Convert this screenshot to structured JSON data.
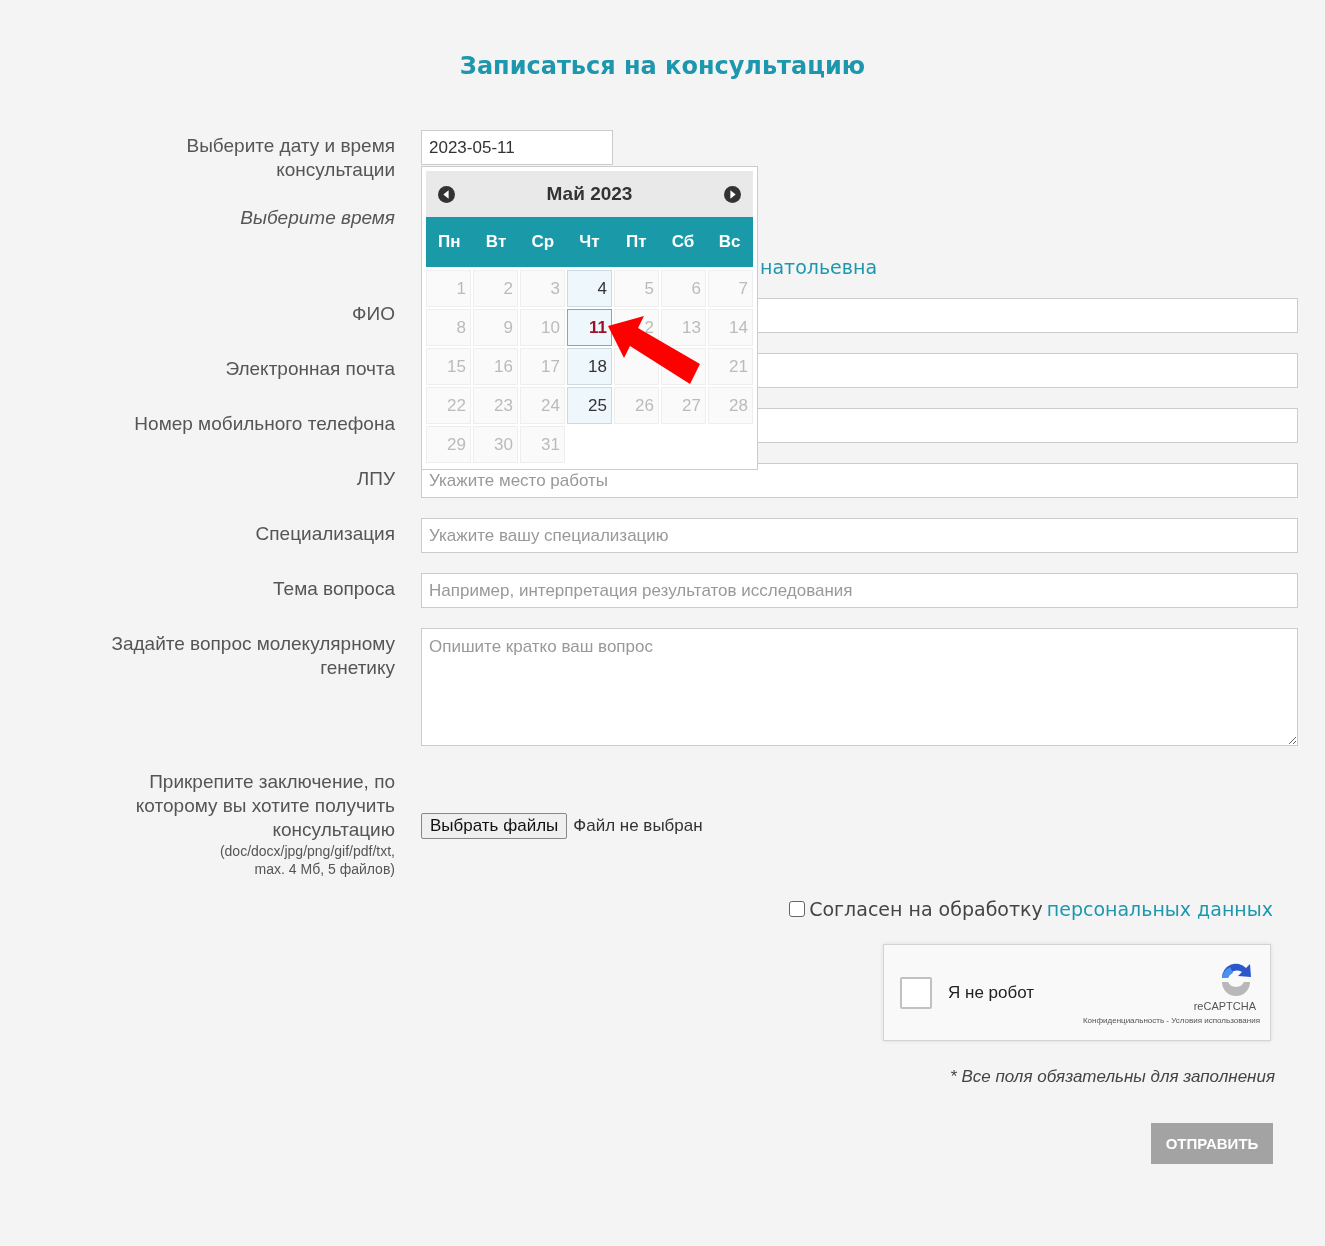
{
  "title": "Записаться на консультацию",
  "date_field": {
    "label": "Выберите дату и время консультации",
    "value": "2023-05-11"
  },
  "datepicker": {
    "month": "Май 2023",
    "weekdays": [
      "Пн",
      "Вт",
      "Ср",
      "Чт",
      "Пт",
      "Сб",
      "Вс"
    ],
    "weeks": [
      [
        {
          "text": "1",
          "kind": "disabled",
          "selected": false
        },
        {
          "text": "2",
          "kind": "disabled",
          "selected": false
        },
        {
          "text": "3",
          "kind": "disabled",
          "selected": false
        },
        {
          "text": "4",
          "kind": "available",
          "selected": false
        },
        {
          "text": "5",
          "kind": "disabled",
          "selected": false
        },
        {
          "text": "6",
          "kind": "disabled",
          "selected": false
        },
        {
          "text": "7",
          "kind": "disabled",
          "selected": false
        }
      ],
      [
        {
          "text": "8",
          "kind": "disabled",
          "selected": false
        },
        {
          "text": "9",
          "kind": "disabled",
          "selected": false
        },
        {
          "text": "10",
          "kind": "disabled",
          "selected": false
        },
        {
          "text": "11",
          "kind": "available",
          "selected": true
        },
        {
          "text": "2",
          "kind": "disabled",
          "selected": false
        },
        {
          "text": "13",
          "kind": "disabled",
          "selected": false
        },
        {
          "text": "14",
          "kind": "disabled",
          "selected": false
        }
      ],
      [
        {
          "text": "15",
          "kind": "disabled",
          "selected": false
        },
        {
          "text": "16",
          "kind": "disabled",
          "selected": false
        },
        {
          "text": "17",
          "kind": "disabled",
          "selected": false
        },
        {
          "text": "18",
          "kind": "available",
          "selected": false
        },
        {
          "kind": "disabled",
          "selected": false
        },
        {
          "kind": "disabled",
          "selected": false
        },
        {
          "text": "21",
          "kind": "disabled",
          "selected": false
        }
      ],
      [
        {
          "text": "22",
          "kind": "disabled",
          "selected": false
        },
        {
          "text": "23",
          "kind": "disabled",
          "selected": false
        },
        {
          "text": "24",
          "kind": "disabled",
          "selected": false
        },
        {
          "text": "25",
          "kind": "available",
          "selected": false
        },
        {
          "text": "26",
          "kind": "disabled",
          "selected": false
        },
        {
          "text": "27",
          "kind": "disabled",
          "selected": false
        },
        {
          "text": "28",
          "kind": "disabled",
          "selected": false
        }
      ],
      [
        {
          "text": "29",
          "kind": "disabled",
          "selected": false
        },
        {
          "text": "30",
          "kind": "disabled",
          "selected": false
        },
        {
          "text": "31",
          "kind": "disabled",
          "selected": false
        }
      ]
    ]
  },
  "time": {
    "label": "Выберите время",
    "partial_text": "натольевна"
  },
  "fields": [
    {
      "label": "ФИО"
    },
    {
      "label": "Электронная почта"
    },
    {
      "label": "Номер мобильного телефона"
    },
    {
      "label": "ЛПУ",
      "placeholder": "Укажите место работы"
    },
    {
      "label": "Специализация",
      "placeholder": "Укажите вашу специализацию"
    },
    {
      "label": "Тема вопроса",
      "placeholder": "Например, интерпретация результатов исследования"
    }
  ],
  "question": {
    "label": "Задайте вопрос молекулярному генетику",
    "placeholder": "Опишите кратко ваш вопрос"
  },
  "attachment": {
    "label": "Прикрепите заключение, по которому вы хотите получить консультацию",
    "hint": [
      "(doc/docx/jpg/png/gif/pdf/txt,",
      "max. 4 Мб, 5 файлов)"
    ],
    "button": "Выбрать файлы",
    "status": "Файл не выбран"
  },
  "consent": {
    "checked": false,
    "text": "Согласен на обработку",
    "link": "персональных данных"
  },
  "captcha": {
    "checked": false,
    "label": "Я не робот",
    "brand": "reCAPTCHA",
    "links": "Конфиденциальность - Условия использования"
  },
  "note": "* Все поля обязательны для заполнения",
  "submit": "ОТПРАВИТЬ"
}
